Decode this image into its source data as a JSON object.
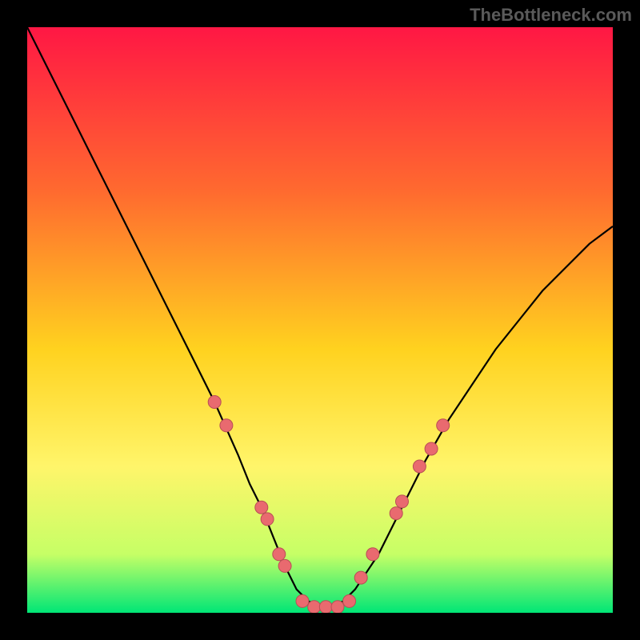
{
  "watermark": "TheBottleneck.com",
  "colors": {
    "gradient": [
      "#ff1744",
      "#ff6a2f",
      "#ffd21f",
      "#fff56a",
      "#c6ff66",
      "#00e676"
    ],
    "gradient_offsets": [
      0,
      0.28,
      0.55,
      0.75,
      0.9,
      1.0
    ],
    "curve": "#000000",
    "dot_fill": "#e96a6f",
    "dot_stroke": "#b84f55"
  },
  "chart_data": {
    "type": "line",
    "title": "",
    "xlabel": "",
    "ylabel": "",
    "xlim": [
      0,
      100
    ],
    "ylim": [
      0,
      100
    ],
    "curve": {
      "x": [
        0,
        4,
        8,
        12,
        16,
        20,
        24,
        28,
        32,
        36,
        38,
        40,
        42,
        44,
        46,
        48,
        50,
        52,
        54,
        56,
        60,
        64,
        68,
        72,
        76,
        80,
        84,
        88,
        92,
        96,
        100
      ],
      "y": [
        100,
        92,
        84,
        76,
        68,
        60,
        52,
        44,
        36,
        27,
        22,
        18,
        13,
        8,
        4,
        2,
        1,
        1,
        2,
        4,
        10,
        18,
        26,
        33,
        39,
        45,
        50,
        55,
        59,
        63,
        66
      ]
    },
    "series": [
      {
        "name": "markers",
        "points": [
          {
            "x": 32,
            "y": 36
          },
          {
            "x": 34,
            "y": 32
          },
          {
            "x": 40,
            "y": 18
          },
          {
            "x": 41,
            "y": 16
          },
          {
            "x": 43,
            "y": 10
          },
          {
            "x": 44,
            "y": 8
          },
          {
            "x": 47,
            "y": 2
          },
          {
            "x": 49,
            "y": 1
          },
          {
            "x": 51,
            "y": 1
          },
          {
            "x": 53,
            "y": 1
          },
          {
            "x": 55,
            "y": 2
          },
          {
            "x": 57,
            "y": 6
          },
          {
            "x": 59,
            "y": 10
          },
          {
            "x": 63,
            "y": 17
          },
          {
            "x": 64,
            "y": 19
          },
          {
            "x": 67,
            "y": 25
          },
          {
            "x": 69,
            "y": 28
          },
          {
            "x": 71,
            "y": 32
          }
        ]
      }
    ]
  }
}
